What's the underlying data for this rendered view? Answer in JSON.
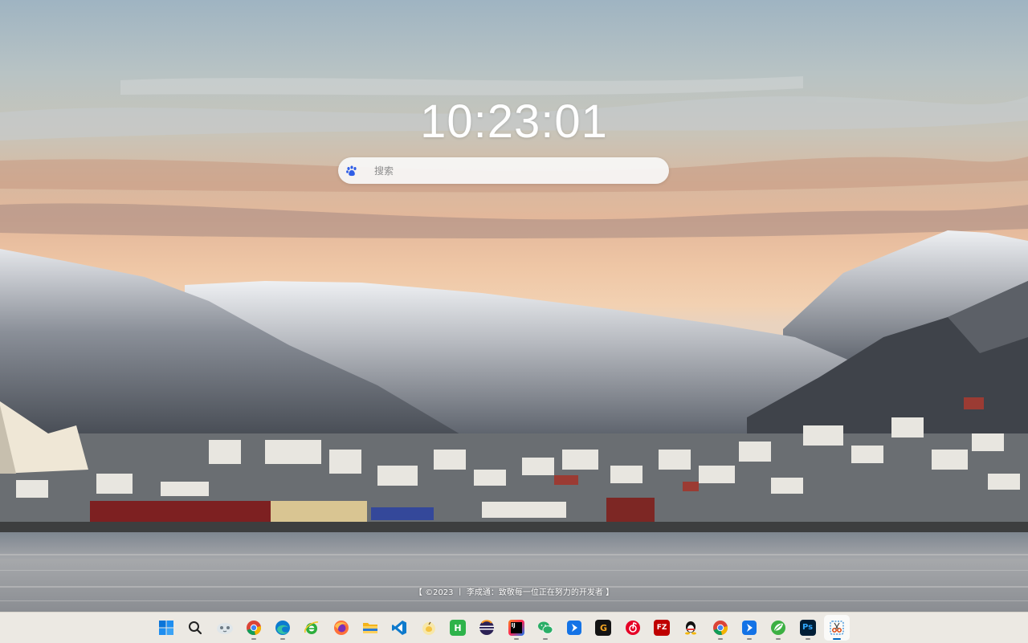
{
  "clock": {
    "time": "10:23:01"
  },
  "search": {
    "placeholder": "搜索",
    "engine_icon": "baidu-paw-icon"
  },
  "footer": {
    "text": "【 ©2023 丨 李成通：致敬每一位正在努力的开发者 】"
  },
  "taskbar": {
    "items": [
      {
        "name": "start",
        "icon": "windows-start-icon",
        "running": false,
        "active": false
      },
      {
        "name": "search",
        "icon": "search-icon",
        "running": false,
        "active": false
      },
      {
        "name": "widgets",
        "icon": "widgets-icon",
        "running": false,
        "active": false
      },
      {
        "name": "chrome",
        "icon": "chrome-icon",
        "running": true,
        "active": false
      },
      {
        "name": "edge",
        "icon": "edge-icon",
        "running": true,
        "active": false
      },
      {
        "name": "ie",
        "icon": "internet-explorer-icon",
        "running": false,
        "active": false
      },
      {
        "name": "firefox",
        "icon": "firefox-icon",
        "running": false,
        "active": false
      },
      {
        "name": "explorer",
        "icon": "file-explorer-icon",
        "running": false,
        "active": false
      },
      {
        "name": "vscode",
        "icon": "vscode-icon",
        "running": false,
        "active": false
      },
      {
        "name": "peach",
        "icon": "peach-app-icon",
        "running": false,
        "active": false
      },
      {
        "name": "hbuilder",
        "icon": "hbuilder-icon",
        "running": false,
        "active": false
      },
      {
        "name": "eclipse",
        "icon": "eclipse-icon",
        "running": false,
        "active": false
      },
      {
        "name": "intellij",
        "icon": "intellij-idea-icon",
        "running": true,
        "active": false
      },
      {
        "name": "wechat",
        "icon": "wechat-icon",
        "running": true,
        "active": false
      },
      {
        "name": "feishu",
        "icon": "blue-arrow-app-icon",
        "running": false,
        "active": false
      },
      {
        "name": "app-g",
        "icon": "g-app-icon",
        "running": false,
        "active": false
      },
      {
        "name": "netease",
        "icon": "netease-music-icon",
        "running": false,
        "active": false
      },
      {
        "name": "filezilla",
        "icon": "filezilla-icon",
        "running": false,
        "active": false
      },
      {
        "name": "qq",
        "icon": "qq-penguin-icon",
        "running": false,
        "active": false
      },
      {
        "name": "chrome2",
        "icon": "chrome-icon",
        "running": true,
        "active": false
      },
      {
        "name": "feishu2",
        "icon": "blue-arrow-app-icon",
        "running": true,
        "active": false
      },
      {
        "name": "green-app",
        "icon": "green-leaf-app-icon",
        "running": true,
        "active": false
      },
      {
        "name": "photoshop",
        "icon": "photoshop-icon",
        "label": "Ps",
        "running": true,
        "active": false
      },
      {
        "name": "snipping",
        "icon": "snipping-tool-icon",
        "running": true,
        "active": true
      }
    ],
    "labels": {
      "ps": "Ps",
      "idea": "IJ",
      "hbuilder": "H",
      "app_g": "G",
      "filezilla": "FZ"
    }
  },
  "colors": {
    "clock_text": "#ffffff",
    "taskbar_bg": "#ece9e3",
    "active_indicator": "#0067c0",
    "search_bg": "#f8f8f8"
  }
}
